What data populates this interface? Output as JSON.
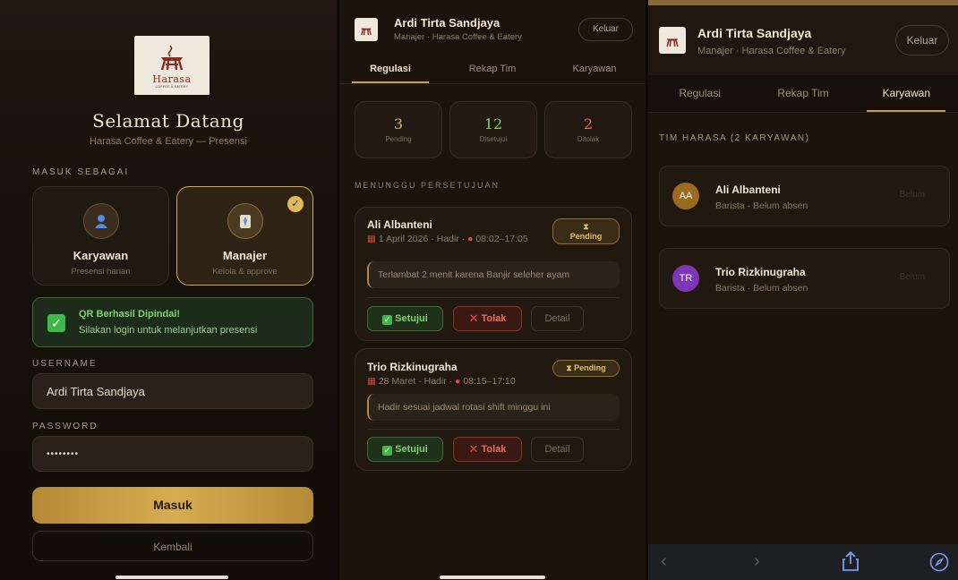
{
  "colors": {
    "gold": "#d3a84a",
    "bg": "#1b140d",
    "green": "#7fd46f",
    "red": "#ee6b5b"
  },
  "login": {
    "logo_text": "Harasa",
    "logo_sub": "COFFEE & EATERY",
    "title": "Selamat Datang",
    "subtitle": "Harasa Coffee & Eatery — Presensi",
    "role_label": "MASUK SEBAGAI",
    "roles": [
      {
        "name": "Karyawan",
        "desc": "Presensi harian",
        "icon": "person-icon"
      },
      {
        "name": "Manajer",
        "desc": "Kelola & approve",
        "icon": "manager-icon"
      }
    ],
    "success_title": "QR Berhasil Dipindai!",
    "success_desc": "Silakan login untuk melanjutkan presensi",
    "username_label": "USERNAME",
    "username_value": "Ardi Tirta Sandjaya",
    "password_label": "PASSWORD",
    "password_value": "••••••••",
    "submit_label": "Masuk",
    "back_label": "Kembali"
  },
  "manager": {
    "name": "Ardi Tirta Sandjaya",
    "role": "Manajer · Harasa Coffee & Eatery",
    "logout": "Keluar",
    "tabs": [
      "Regulasi",
      "Rekap Tim",
      "Karyawan"
    ],
    "stats": [
      {
        "num": "3",
        "cap": "Pending"
      },
      {
        "num": "12",
        "cap": "Disetujui"
      },
      {
        "num": "2",
        "cap": "Ditolak"
      }
    ],
    "section": "MENUNGGU PERSETUJUAN",
    "requests": [
      {
        "name": "Ali Albanteni",
        "meta_date": "1 April 2026 · Hadir ·",
        "meta_time": "08:02–17:05",
        "badge": "Pending",
        "note": "Terlambat 2 menit karena Banjir seleher ayam"
      },
      {
        "name": "Trio Rizkinugraha",
        "meta_date": "28 Maret · Hadir ·",
        "meta_time": "08:15–17:10",
        "badge": "Pending",
        "note": "Hadir sesuai jadwal rotasi shift minggu ini"
      }
    ],
    "btn_approve": "Setujui",
    "btn_reject": "Tolak",
    "btn_detail": "Detail"
  },
  "team": {
    "section": "TIM HARASA (2 KARYAWAN)",
    "employees": [
      {
        "initials": "AA",
        "name": "Ali Albanteni",
        "status": "Barista · Belum absen",
        "badge": "Belum",
        "color": "#9a6a1e"
      },
      {
        "initials": "TR",
        "name": "Trio Rizkinugraha",
        "status": "Barista · Belum absen",
        "badge": "Belum",
        "color": "#7d36b8"
      }
    ]
  }
}
